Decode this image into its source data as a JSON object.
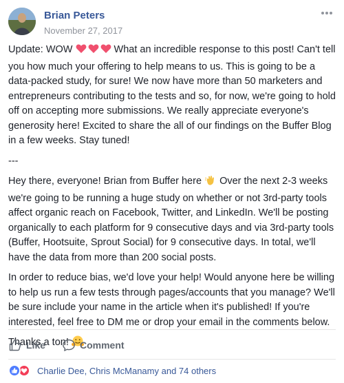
{
  "post": {
    "author": "Brian Peters",
    "date": "November 27, 2017",
    "paragraphs": {
      "update_prefix": "Update: WOW",
      "update_rest": "What an incredible response to this post! Can't tell you how much your offering to help means to us. This is going to be a data-packed study, for sure! We now have more than 50 marketers and entrepreneurs contributing to the tests and so, for now, we're going to hold off on accepting more submissions. We really appreciate everyone's generosity here! Excited to share the all of our findings on the Buffer Blog in a few weeks. Stay tuned!",
      "separator": "---",
      "intro_prefix": "Hey there, everyone! Brian from Buffer here",
      "intro_rest": "Over the next 2-3 weeks we're going to be running a huge study on whether or not 3rd-party tools affect organic reach on Facebook, Twitter, and LinkedIn. We'll be posting organically to each platform for 9 consecutive days and via 3rd-party tools (Buffer, Hootsuite, Sprout Social) for 9 consecutive days. In total, we'll have the data from more than 200 social posts.",
      "help": "In order to reduce bias, we'd love your help! Would anyone here be willing to help us run a few tests through pages/accounts that you manage? We'll be sure include your name in the article when it's published! If you're interested, feel free to DM me or drop your email in the comments below.",
      "thanks": "Thanks a ton!"
    }
  },
  "actions": {
    "like_label": "Like",
    "comment_label": "Comment"
  },
  "reactions": {
    "summary": "Charlie Dee, Chris McManamy and 74 others"
  },
  "colors": {
    "name_link": "#385898",
    "meta_gray": "#90949c",
    "action_gray": "#606770",
    "heart_red": "#f33e58",
    "like_blue": "#4f7dff"
  },
  "icons": {
    "more": "ellipsis-icon",
    "like": "thumbs-up-icon",
    "comment": "comment-bubble-icon",
    "heart_emoji": "heart-icon",
    "wave_emoji": "waving-hand-icon",
    "hug_emoji": "hugging-face-icon"
  }
}
